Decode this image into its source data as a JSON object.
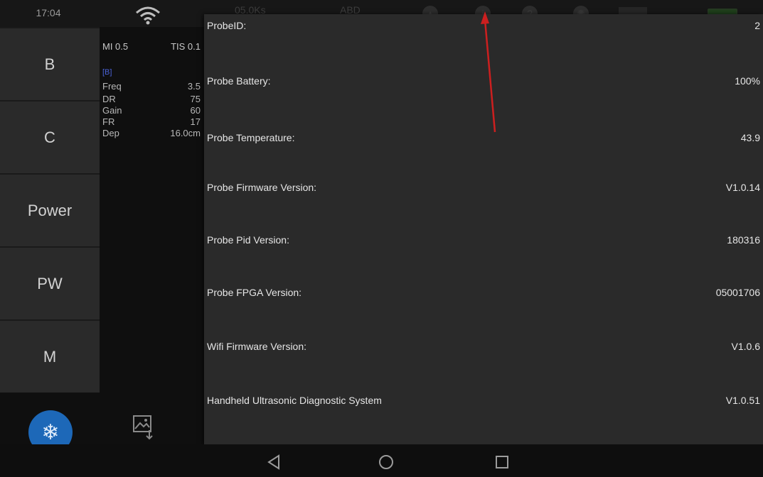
{
  "status_bar": {
    "time": "17:04",
    "network_speed": "05.0Ks",
    "app_label": "ABD"
  },
  "modes": [
    {
      "label": "B"
    },
    {
      "label": "C"
    },
    {
      "label": "Power"
    },
    {
      "label": "PW"
    },
    {
      "label": "M"
    }
  ],
  "params": {
    "mi_label": "MI 0.5",
    "tis_label": "TIS 0.1",
    "mode_tag": "[B]",
    "rows": [
      {
        "name": "Freq",
        "value": "3.5"
      },
      {
        "name": "DR",
        "value": "75"
      },
      {
        "name": "Gain",
        "value": "60"
      },
      {
        "name": "FR",
        "value": "17"
      },
      {
        "name": "Dep",
        "value": "16.0cm"
      }
    ]
  },
  "info_dialog": {
    "rows": [
      {
        "label": "ProbeID:",
        "value": "2"
      },
      {
        "label": "Probe Battery:",
        "value": "100%"
      },
      {
        "label": "Probe Temperature:",
        "value": "43.9"
      },
      {
        "label": "Probe Firmware Version:",
        "value": "V1.0.14"
      },
      {
        "label": "Probe Pid Version:",
        "value": "180316"
      },
      {
        "label": "Probe FPGA Version:",
        "value": "05001706"
      },
      {
        "label": "Wifi Firmware Version:",
        "value": "V1.0.6"
      },
      {
        "label": "Handheld Ultrasonic Diagnostic System",
        "value": "V1.0.51"
      }
    ]
  },
  "icons": {
    "freeze": "snowflake-icon",
    "image_save": "image-save-icon",
    "nav_back": "back-triangle-icon",
    "nav_home": "home-circle-icon",
    "nav_recent": "recent-square-icon"
  },
  "colors": {
    "freeze_button": "#1d68b8",
    "annotation_arrow": "#cc1f1f",
    "mode_tag": "#4a63d8"
  }
}
